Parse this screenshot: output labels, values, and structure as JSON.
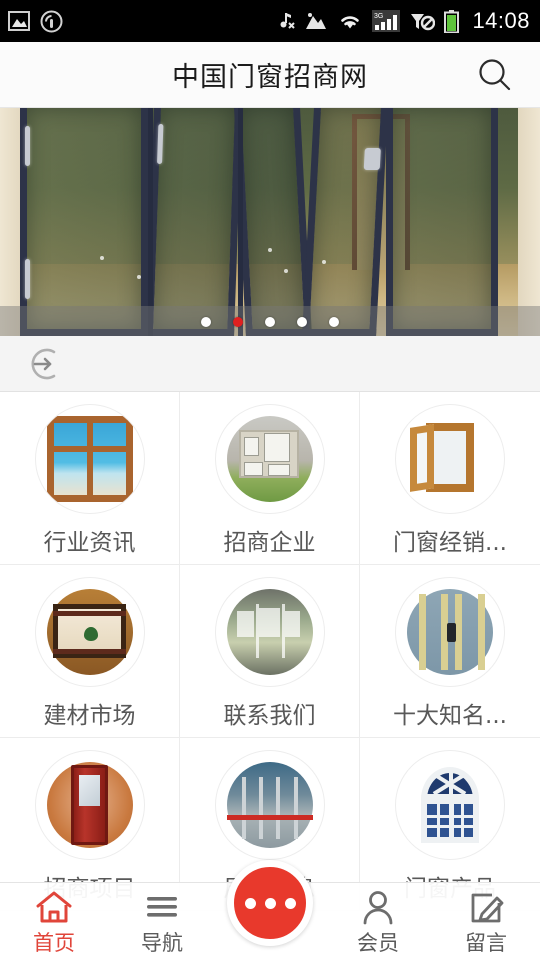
{
  "statusbar": {
    "time": "14:08",
    "left_icons": [
      "image-icon",
      "broadcast-icon"
    ],
    "right_icons": [
      "music-off-icon",
      "mountain-icon",
      "wifi-icon",
      "signal-3g-icon",
      "no-sim-icon",
      "battery-icon"
    ],
    "network": "3G"
  },
  "header": {
    "title": "中国门窗招商网",
    "search_icon": "search-icon"
  },
  "banner": {
    "alt": "folding-glass-doors-photo",
    "dots_count": 5,
    "active_dot": 2,
    "active_color": "#e02020",
    "inactive_color": "#ffffff"
  },
  "refresh_bar": {
    "icon": "refresh-enter-icon"
  },
  "grid": {
    "items": [
      {
        "label": "行业资讯",
        "icon": "window-beach-thumb"
      },
      {
        "label": "招商企业",
        "icon": "house-thumb"
      },
      {
        "label": "门窗经销...",
        "icon": "open-wood-window-thumb"
      },
      {
        "label": "建材市场",
        "icon": "stained-glass-thumb"
      },
      {
        "label": "联系我们",
        "icon": "office-interior-thumb"
      },
      {
        "label": "十大知名...",
        "icon": "blue-panel-door-thumb"
      },
      {
        "label": "招商项目",
        "icon": "red-door-thumb"
      },
      {
        "label": "展会信息",
        "icon": "glass-storefront-thumb"
      },
      {
        "label": "门窗产品",
        "icon": "arched-window-thumb"
      }
    ]
  },
  "bottomnav": {
    "items": [
      {
        "label": "首页",
        "icon": "home-icon",
        "active": true
      },
      {
        "label": "导航",
        "icon": "menu-icon",
        "active": false
      },
      {
        "label": "会员",
        "icon": "user-icon",
        "active": false
      },
      {
        "label": "留言",
        "icon": "edit-icon",
        "active": false
      }
    ],
    "fab": {
      "icon": "more-dots-icon",
      "color": "#e8392c"
    },
    "active_color": "#e0453a",
    "inactive_color": "#5a5a5a"
  }
}
